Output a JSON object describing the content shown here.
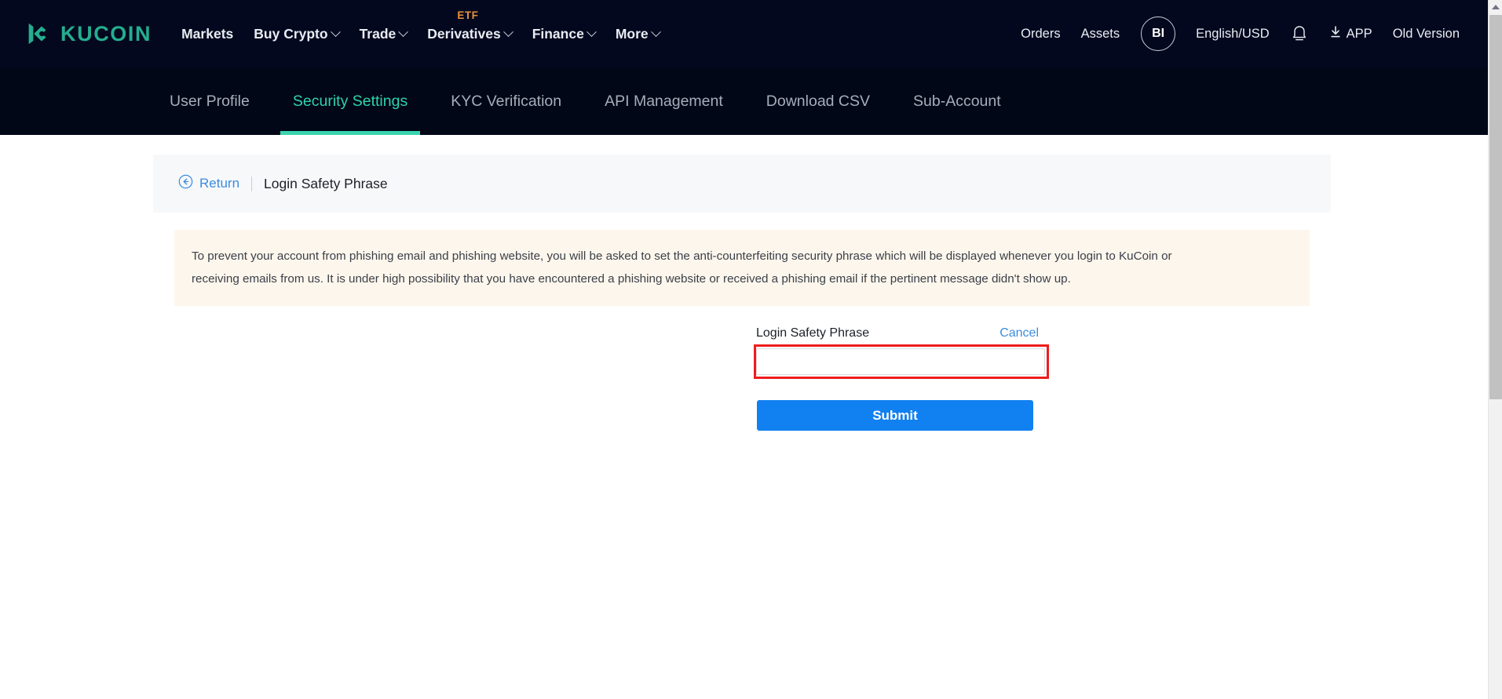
{
  "header": {
    "logo_text": "KUCOIN",
    "logo_icon": "kucoin-logo-icon",
    "nav": [
      {
        "label": "Markets",
        "caret": false,
        "badge": ""
      },
      {
        "label": "Buy Crypto",
        "caret": true,
        "badge": ""
      },
      {
        "label": "Trade",
        "caret": true,
        "badge": ""
      },
      {
        "label": "Derivatives",
        "caret": true,
        "badge": "ETF"
      },
      {
        "label": "Finance",
        "caret": true,
        "badge": ""
      },
      {
        "label": "More",
        "caret": true,
        "badge": ""
      }
    ],
    "orders_label": "Orders",
    "assets_label": "Assets",
    "avatar_initials": "BI",
    "language_label": "English/USD",
    "bell_icon": "notification-bell-icon",
    "app_label": "APP",
    "app_icon": "download-icon",
    "old_version_label": "Old Version",
    "accent_teal": "#24ae8f",
    "badge_orange": "#e8913c"
  },
  "subnav": {
    "tabs": [
      {
        "label": "User Profile",
        "active": false
      },
      {
        "label": "Security Settings",
        "active": true
      },
      {
        "label": "KYC Verification",
        "active": false
      },
      {
        "label": "API Management",
        "active": false
      },
      {
        "label": "Download CSV",
        "active": false
      },
      {
        "label": "Sub-Account",
        "active": false
      }
    ],
    "active_color": "#2ed3ac"
  },
  "card": {
    "return_label": "Return",
    "return_icon": "circle-arrow-left-icon",
    "title": "Login Safety Phrase",
    "notice_line1": "To prevent your account from phishing email and phishing website, you will be asked to set the anti-counterfeiting security phrase which will be displayed whenever you login to KuCoin or",
    "notice_line2": "receiving emails from us. It is under high possibility that you have encountered a phishing website or received a phishing email if the pertinent message didn't show up.",
    "notice_bg": "#fdf6ec"
  },
  "form": {
    "field_label": "Login Safety Phrase",
    "cancel_label": "Cancel",
    "input_value": "",
    "input_placeholder": "",
    "submit_label": "Submit",
    "submit_color": "#1180f0",
    "highlight_color": "#ee1d1d"
  },
  "scrollbar": {
    "up_arrow_icon": "scroll-up-arrow-icon",
    "thumb_name": "scroll-thumb"
  }
}
